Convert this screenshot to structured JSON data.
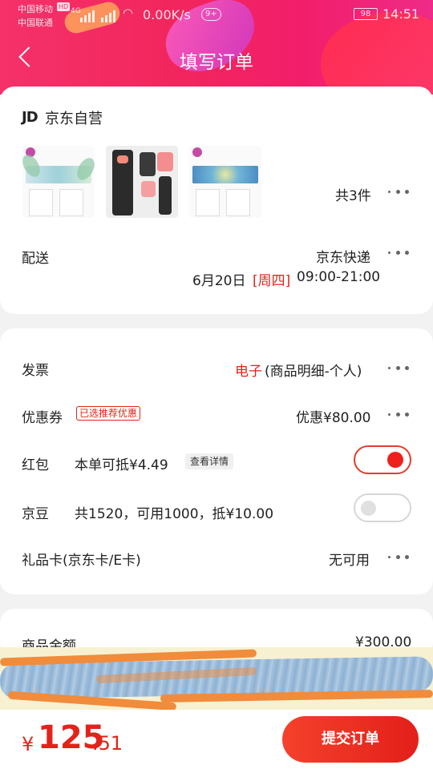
{
  "status_bar": {
    "carrier1": "中国移动",
    "hd": "HD",
    "net": "4G",
    "carrier2": "中国联通",
    "speed": "0.00K/s",
    "notifications": "9+",
    "battery": "98",
    "time": "14:51"
  },
  "header": {
    "title": "填写订单",
    "back_icon": "chevron-left-icon"
  },
  "shop": {
    "logo": "JD",
    "name": "京东自营",
    "item_count": "共3件"
  },
  "delivery": {
    "label": "配送",
    "carrier": "京东快递",
    "date": "6月20日",
    "weekday": "[周四]",
    "time": "09:00-21:00"
  },
  "invoice": {
    "label": "发票",
    "type": "电子",
    "detail": "(商品明细-个人)"
  },
  "coupon": {
    "label": "优惠券",
    "badge": "已选推荐优惠",
    "value": "优惠¥80.00"
  },
  "red_packet": {
    "label": "红包",
    "info": "本单可抵¥4.49",
    "detail_btn": "查看详情",
    "enabled": true
  },
  "jingdou": {
    "label": "京豆",
    "info": "共1520，可用1000，抵¥10.00",
    "enabled": false
  },
  "gift_card": {
    "label": "礼品卡(京东卡/E卡)",
    "value": "无可用"
  },
  "summary": {
    "goods_label": "商品金额",
    "goods_value": "¥300.00"
  },
  "footer": {
    "currency": "¥",
    "total_int": "125",
    "total_dec": ".51",
    "submit": "提交订单"
  },
  "colors": {
    "accent": "#e2231a",
    "header_start": "#f5316a",
    "header_end": "#ee2b88"
  }
}
